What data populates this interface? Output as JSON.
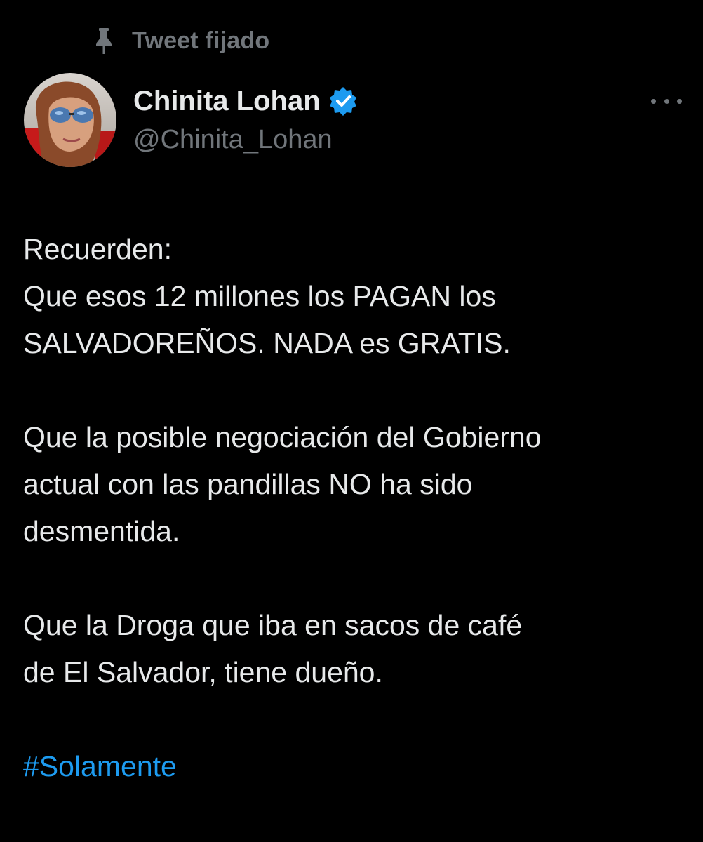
{
  "pinned": {
    "icon": "pin-icon",
    "label": "Tweet fijado"
  },
  "author": {
    "avatar_icon": "profile-photo",
    "display_name": "Chinita Lohan",
    "verified_icon": "verified-badge-icon",
    "handle": "@Chinita_Lohan"
  },
  "menu": {
    "icon": "more-options-icon"
  },
  "tweet": {
    "paragraph1": [
      "Recuerden:",
      "Que esos 12 millones los PAGAN los",
      "SALVADOREÑOS. NADA es GRATIS."
    ],
    "paragraph2": [
      "Que la posible negociación del Gobierno",
      "actual con las pandillas NO ha sido",
      "desmentida."
    ],
    "paragraph3": [
      "Que la Droga que iba en sacos de café",
      "de El Salvador, tiene dueño."
    ],
    "hashtag": "#Solamente"
  },
  "colors": {
    "background": "#000000",
    "primary_text": "#e7e9ea",
    "secondary_text": "#71767b",
    "link": "#1d9bf0",
    "verified_badge": "#1d9bf0"
  }
}
